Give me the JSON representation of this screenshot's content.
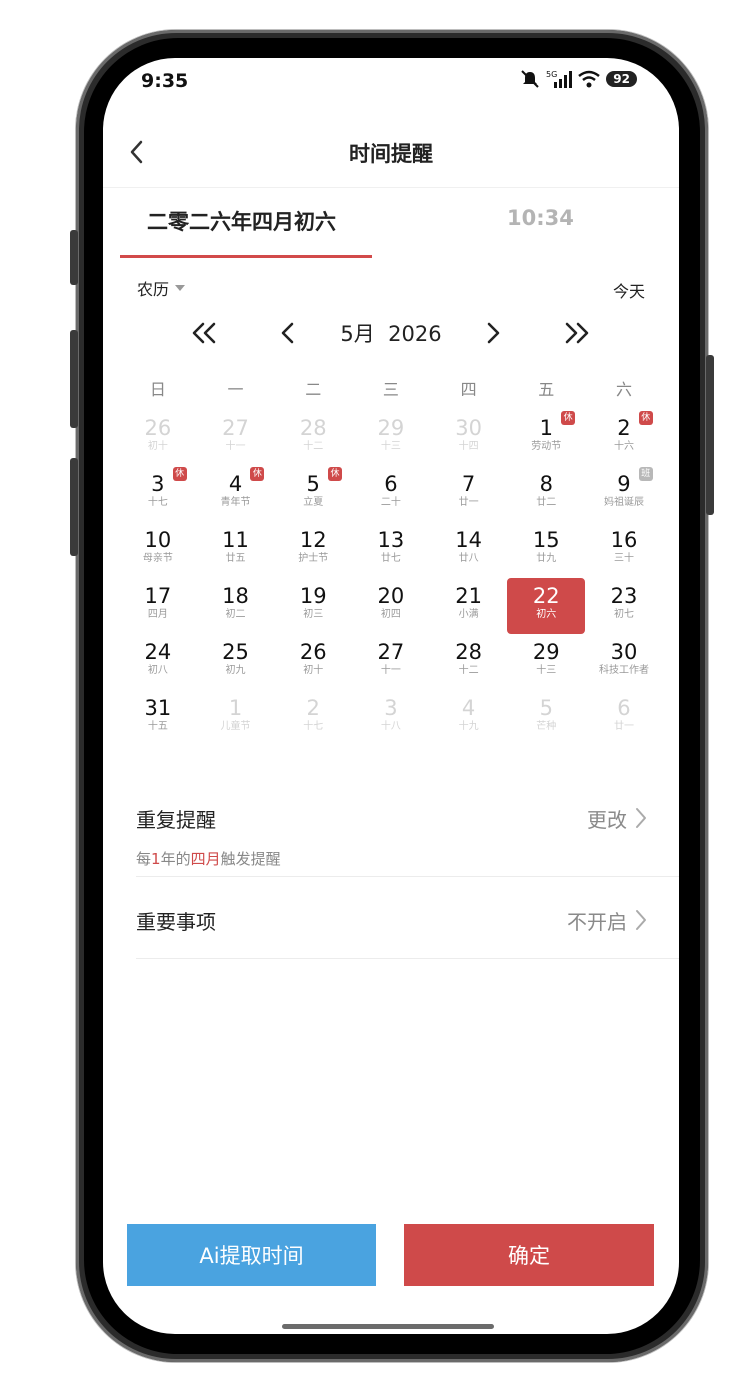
{
  "status_bar": {
    "time": "9:35",
    "network": "5G",
    "battery": "92",
    "icons": [
      "mute-icon",
      "signal-icon",
      "wifi-icon",
      "battery-icon"
    ]
  },
  "header": {
    "title": "时间提醒",
    "back_icon": "chevron-left-icon"
  },
  "tabs": {
    "date_label": "二零二六年四月初六",
    "time_label": "10:34",
    "active": "date",
    "active_color": "#d24a4a"
  },
  "calendar": {
    "mode_label": "农历",
    "today_label": "今天",
    "month_label": "5月  2026",
    "weekdays": [
      "日",
      "一",
      "二",
      "三",
      "四",
      "五",
      "六"
    ],
    "days": [
      {
        "num": "26",
        "sub": "初十",
        "other": true
      },
      {
        "num": "27",
        "sub": "十一",
        "other": true
      },
      {
        "num": "28",
        "sub": "十二",
        "other": true
      },
      {
        "num": "29",
        "sub": "十三",
        "other": true
      },
      {
        "num": "30",
        "sub": "十四",
        "other": true
      },
      {
        "num": "1",
        "sub": "劳动节",
        "badge": "休",
        "badge_type": "rest"
      },
      {
        "num": "2",
        "sub": "十六",
        "badge": "休",
        "badge_type": "rest"
      },
      {
        "num": "3",
        "sub": "十七",
        "badge": "休",
        "badge_type": "rest"
      },
      {
        "num": "4",
        "sub": "青年节",
        "badge": "休",
        "badge_type": "rest"
      },
      {
        "num": "5",
        "sub": "立夏",
        "badge": "休",
        "badge_type": "rest"
      },
      {
        "num": "6",
        "sub": "二十"
      },
      {
        "num": "7",
        "sub": "廿一"
      },
      {
        "num": "8",
        "sub": "廿二"
      },
      {
        "num": "9",
        "sub": "妈祖诞辰",
        "badge": "班",
        "badge_type": "work"
      },
      {
        "num": "10",
        "sub": "母亲节"
      },
      {
        "num": "11",
        "sub": "廿五"
      },
      {
        "num": "12",
        "sub": "护士节"
      },
      {
        "num": "13",
        "sub": "廿七"
      },
      {
        "num": "14",
        "sub": "廿八"
      },
      {
        "num": "15",
        "sub": "廿九"
      },
      {
        "num": "16",
        "sub": "三十"
      },
      {
        "num": "17",
        "sub": "四月"
      },
      {
        "num": "18",
        "sub": "初二"
      },
      {
        "num": "19",
        "sub": "初三"
      },
      {
        "num": "20",
        "sub": "初四"
      },
      {
        "num": "21",
        "sub": "小满"
      },
      {
        "num": "22",
        "sub": "初六",
        "selected": true
      },
      {
        "num": "23",
        "sub": "初七"
      },
      {
        "num": "24",
        "sub": "初八"
      },
      {
        "num": "25",
        "sub": "初九"
      },
      {
        "num": "26",
        "sub": "初十"
      },
      {
        "num": "27",
        "sub": "十一"
      },
      {
        "num": "28",
        "sub": "十二"
      },
      {
        "num": "29",
        "sub": "十三"
      },
      {
        "num": "30",
        "sub": "科技工作者"
      },
      {
        "num": "31",
        "sub": "十五"
      },
      {
        "num": "1",
        "sub": "儿童节",
        "other": true
      },
      {
        "num": "2",
        "sub": "十七",
        "other": true
      },
      {
        "num": "3",
        "sub": "十八",
        "other": true
      },
      {
        "num": "4",
        "sub": "十九",
        "other": true
      },
      {
        "num": "5",
        "sub": "芒种",
        "other": true
      },
      {
        "num": "6",
        "sub": "廿一",
        "other": true
      }
    ]
  },
  "repeat": {
    "label": "重复提醒",
    "value": "更改",
    "desc_prefix": "每",
    "desc_num": "1",
    "desc_mid": "年的",
    "desc_month": "四月",
    "desc_suffix": "触发提醒"
  },
  "important": {
    "label": "重要事项",
    "value": "不开启"
  },
  "buttons": {
    "ai_label": "Ai提取时间",
    "confirm_label": "确定",
    "ai_color": "#4aa3e0",
    "confirm_color": "#cf4a4a"
  }
}
